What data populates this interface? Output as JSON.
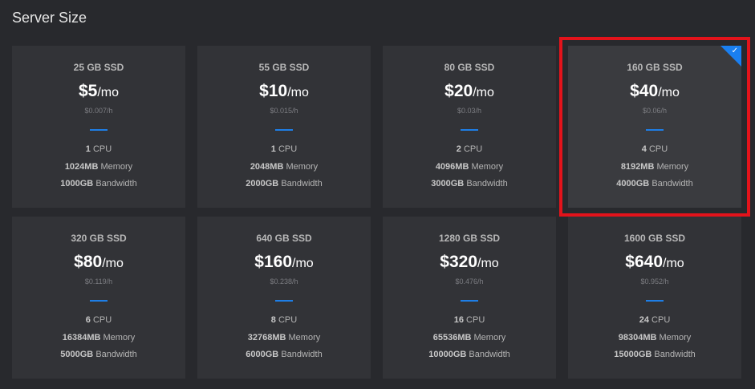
{
  "section": {
    "title": "Server Size"
  },
  "plans": [
    {
      "storage": "25 GB SSD",
      "price": "$5",
      "unit": "/mo",
      "hourly": "$0.007/h",
      "cpu": "1",
      "cpu_label": " CPU",
      "memory": "1024MB",
      "memory_label": " Memory",
      "bandwidth": "1000GB",
      "bandwidth_label": " Bandwidth",
      "selected": false
    },
    {
      "storage": "55 GB SSD",
      "price": "$10",
      "unit": "/mo",
      "hourly": "$0.015/h",
      "cpu": "1",
      "cpu_label": " CPU",
      "memory": "2048MB",
      "memory_label": " Memory",
      "bandwidth": "2000GB",
      "bandwidth_label": " Bandwidth",
      "selected": false
    },
    {
      "storage": "80 GB SSD",
      "price": "$20",
      "unit": "/mo",
      "hourly": "$0.03/h",
      "cpu": "2",
      "cpu_label": " CPU",
      "memory": "4096MB",
      "memory_label": " Memory",
      "bandwidth": "3000GB",
      "bandwidth_label": " Bandwidth",
      "selected": false
    },
    {
      "storage": "160 GB SSD",
      "price": "$40",
      "unit": "/mo",
      "hourly": "$0.06/h",
      "cpu": "4",
      "cpu_label": " CPU",
      "memory": "8192MB",
      "memory_label": " Memory",
      "bandwidth": "4000GB",
      "bandwidth_label": " Bandwidth",
      "selected": true
    },
    {
      "storage": "320 GB SSD",
      "price": "$80",
      "unit": "/mo",
      "hourly": "$0.119/h",
      "cpu": "6",
      "cpu_label": " CPU",
      "memory": "16384MB",
      "memory_label": " Memory",
      "bandwidth": "5000GB",
      "bandwidth_label": " Bandwidth",
      "selected": false
    },
    {
      "storage": "640 GB SSD",
      "price": "$160",
      "unit": "/mo",
      "hourly": "$0.238/h",
      "cpu": "8",
      "cpu_label": " CPU",
      "memory": "32768MB",
      "memory_label": " Memory",
      "bandwidth": "6000GB",
      "bandwidth_label": " Bandwidth",
      "selected": false
    },
    {
      "storage": "1280 GB SSD",
      "price": "$320",
      "unit": "/mo",
      "hourly": "$0.476/h",
      "cpu": "16",
      "cpu_label": " CPU",
      "memory": "65536MB",
      "memory_label": " Memory",
      "bandwidth": "10000GB",
      "bandwidth_label": " Bandwidth",
      "selected": false
    },
    {
      "storage": "1600 GB SSD",
      "price": "$640",
      "unit": "/mo",
      "hourly": "$0.952/h",
      "cpu": "24",
      "cpu_label": " CPU",
      "memory": "98304MB",
      "memory_label": " Memory",
      "bandwidth": "15000GB",
      "bandwidth_label": " Bandwidth",
      "selected": false
    }
  ],
  "icons": {
    "selected_check": "checkmark-icon",
    "check_glyph": "✓"
  },
  "colors": {
    "accent": "#1e7ee6",
    "selection_outline": "#e3131b",
    "background": "#28292d",
    "card": "#323337"
  }
}
